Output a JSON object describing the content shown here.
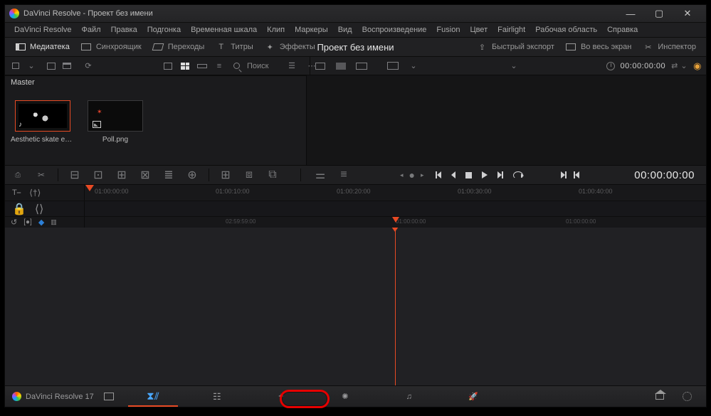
{
  "titlebar": {
    "title": "DaVinci Resolve - Проект без имени"
  },
  "menu": [
    "DaVinci Resolve",
    "Файл",
    "Правка",
    "Подгонка",
    "Временная шкала",
    "Клип",
    "Маркеры",
    "Вид",
    "Воспроизведение",
    "Fusion",
    "Цвет",
    "Fairlight",
    "Рабочая область",
    "Справка"
  ],
  "toolstrip": {
    "media": "Медиатека",
    "sync": "Синхроящик",
    "transitions": "Переходы",
    "titles": "Титры",
    "effects": "Эффекты",
    "project": "Проект без имени",
    "export": "Быстрый экспорт",
    "fullscreen": "Во весь экран",
    "inspector": "Инспектор"
  },
  "subbar": {
    "search": "Поиск",
    "timecode": "00:00:00:00"
  },
  "mediapool": {
    "header": "Master",
    "clips": [
      {
        "name": "Aesthetic skate ed...",
        "type": "audio"
      },
      {
        "name": "Poll.png",
        "type": "image"
      }
    ]
  },
  "ruler1": [
    "01:00:00:00",
    "01:00:10:00",
    "01:00:20:00",
    "01:00:30:00",
    "01:00:40:00"
  ],
  "ruler2": [
    "02:59:59:00",
    "01:00:00:00",
    "01:00:00:00"
  ],
  "timecode_big": "00:00:00:00",
  "pagebar": {
    "title": "DaVinci Resolve 17"
  }
}
